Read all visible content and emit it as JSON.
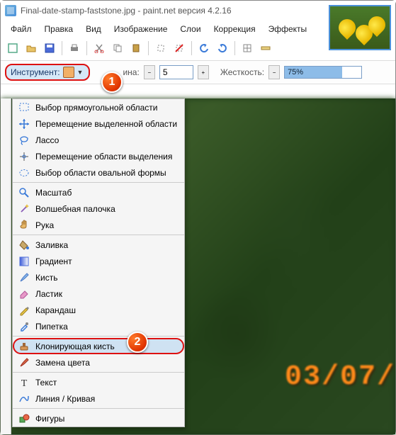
{
  "window": {
    "title": "Final-date-stamp-faststone.jpg - paint.net версия 4.2.16"
  },
  "menubar": [
    "Файл",
    "Правка",
    "Вид",
    "Изображение",
    "Слои",
    "Коррекция",
    "Эффекты"
  ],
  "second_toolbar": {
    "instrument_label": "Инструмент:",
    "width_label": "ина:",
    "width_value": "5",
    "hardness_label": "Жесткость:",
    "hardness_value": "75%"
  },
  "markers": {
    "m1": "1",
    "m2": "2"
  },
  "canvas": {
    "date_stamp": "03/07/"
  },
  "tool_menu": {
    "items": [
      {
        "label": "Выбор прямоугольной области",
        "icon": "rect-select-icon"
      },
      {
        "label": "Перемещение выделенной области",
        "icon": "move-sel-icon"
      },
      {
        "label": "Лассо",
        "icon": "lasso-icon"
      },
      {
        "label": "Перемещение области выделения",
        "icon": "move-selection-icon"
      },
      {
        "label": "Выбор области овальной формы",
        "icon": "ellipse-select-icon"
      },
      {
        "label": "Масштаб",
        "icon": "zoom-icon"
      },
      {
        "label": "Волшебная палочка",
        "icon": "wand-icon"
      },
      {
        "label": "Рука",
        "icon": "hand-icon"
      },
      {
        "label": "Заливка",
        "icon": "bucket-icon"
      },
      {
        "label": "Градиент",
        "icon": "gradient-icon"
      },
      {
        "label": "Кисть",
        "icon": "brush-icon"
      },
      {
        "label": "Ластик",
        "icon": "eraser-icon"
      },
      {
        "label": "Карандаш",
        "icon": "pencil-icon"
      },
      {
        "label": "Пипетка",
        "icon": "eyedropper-icon"
      },
      {
        "label": "Клонирующая кисть",
        "icon": "clone-stamp-icon",
        "highlight": true
      },
      {
        "label": "Замена цвета",
        "icon": "recolor-icon"
      },
      {
        "label": "Текст",
        "icon": "text-icon"
      },
      {
        "label": "Линия / Кривая",
        "icon": "line-icon"
      },
      {
        "label": "Фигуры",
        "icon": "shapes-icon"
      }
    ]
  }
}
